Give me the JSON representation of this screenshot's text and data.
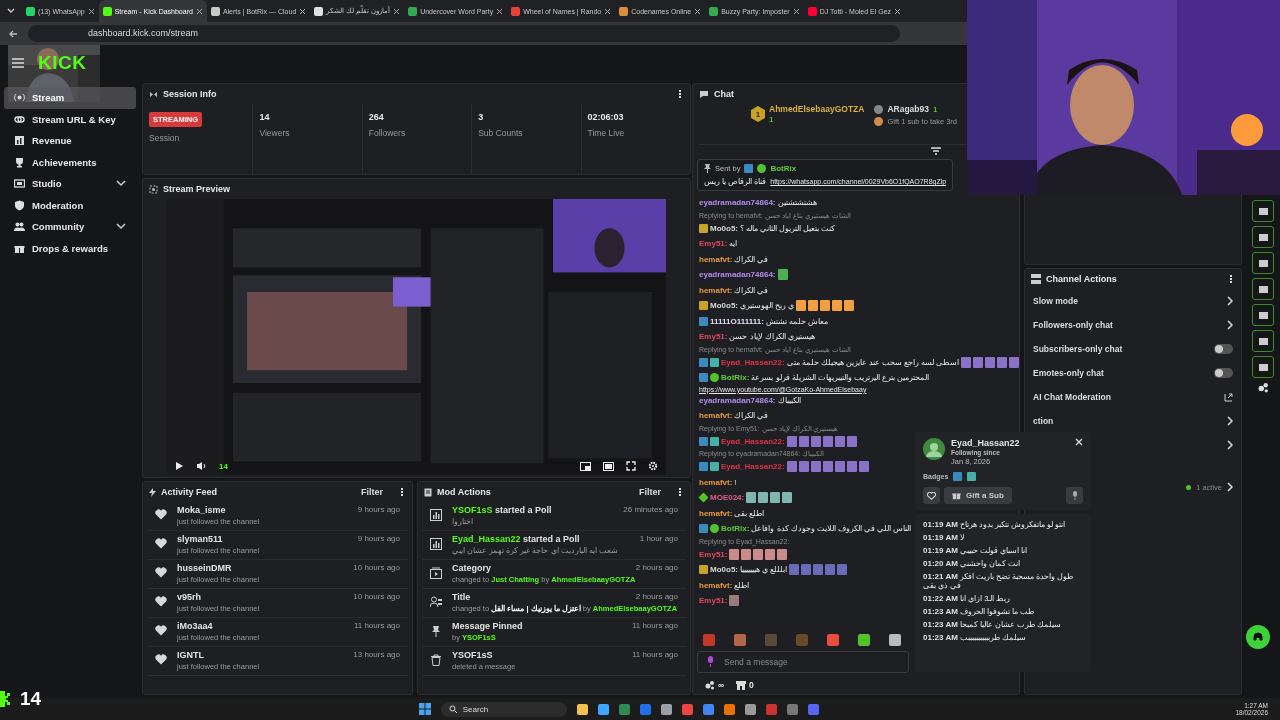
{
  "browser": {
    "tabs": [
      {
        "title": "(13) WhatsApp",
        "selected": false,
        "color": "#25d366"
      },
      {
        "title": "Stream - Kick Dashboard",
        "selected": true,
        "color": "#53fc18"
      },
      {
        "title": "Alerts | BotRix — Cloud",
        "selected": false,
        "color": "#c8c8c8"
      },
      {
        "title": "أمازون تقلّم لك الشكر",
        "selected": false,
        "color": "#e0e0e0"
      },
      {
        "title": "Undercover Word Party",
        "selected": false,
        "color": "#34a853"
      },
      {
        "title": "Wheel of Names | Rando",
        "selected": false,
        "color": "#e94235"
      },
      {
        "title": "Codenames Online",
        "selected": false,
        "color": "#d98c3a"
      },
      {
        "title": "Buzzy Party: Imposter",
        "selected": false,
        "color": "#34a853"
      },
      {
        "title": "DJ Totti - Moled El Gez",
        "selected": false,
        "color": "#ff0033"
      }
    ],
    "address": "dashboard.kick.com/stream"
  },
  "logo": "KICK",
  "sidebar": [
    {
      "label": "Stream",
      "selected": true,
      "has_submenu": false,
      "kind": "stream"
    },
    {
      "label": "Stream URL & Key",
      "selected": false,
      "has_submenu": false,
      "kind": "link"
    },
    {
      "label": "Revenue",
      "selected": false,
      "has_submenu": false,
      "kind": "revenue"
    },
    {
      "label": "Achievements",
      "selected": false,
      "has_submenu": false,
      "kind": "trophy"
    },
    {
      "label": "Studio",
      "selected": false,
      "has_submenu": true,
      "kind": "studio"
    },
    {
      "label": "Moderation",
      "selected": false,
      "has_submenu": false,
      "kind": "shield"
    },
    {
      "label": "Community",
      "selected": false,
      "has_submenu": true,
      "kind": "community"
    },
    {
      "label": "Drops & rewards",
      "selected": false,
      "has_submenu": false,
      "kind": "gift"
    }
  ],
  "session": {
    "title": "Session Info",
    "badge": "STREAMING",
    "stats": [
      {
        "label": "Session"
      },
      {
        "value": "14",
        "label": "Viewers"
      },
      {
        "value": "264",
        "label": "Followers"
      },
      {
        "value": "3",
        "label": "Sub Counts"
      },
      {
        "value": "02:06:03",
        "label": "Time Live"
      }
    ]
  },
  "preview": {
    "title": "Stream Preview",
    "viewers": "14"
  },
  "activity": {
    "title": "Activity Feed",
    "filter": "Filter",
    "items": [
      {
        "name": "Moka_isme",
        "time": "9 hours ago",
        "text": "just followed the channel"
      },
      {
        "name": "slyman511",
        "time": "9 hours ago",
        "text": "just followed the channel"
      },
      {
        "name": "husseinDMR",
        "time": "10 hours ago",
        "text": "just followed the channel"
      },
      {
        "name": "v95rh",
        "time": "10 hours ago",
        "text": "just followed the channel"
      },
      {
        "name": "iMo3aa4",
        "time": "11 hours ago",
        "text": "just followed the channel"
      },
      {
        "name": "IGNTL",
        "time": "13 hours ago",
        "text": "just followed the channel"
      }
    ]
  },
  "mod_actions": {
    "title": "Mod Actions",
    "filter": "Filter",
    "items": [
      {
        "kind": "poll",
        "time": "26 minutes ago",
        "title": [
          {
            "text": "YSOF1sS",
            "kind": "user"
          },
          {
            "text": "started a Poll",
            "kind": "text"
          }
        ],
        "detail": [
          {
            "text": "اختاروا",
            "kind": "text"
          }
        ]
      },
      {
        "kind": "poll",
        "time": "1 hour ago",
        "title": [
          {
            "text": "Eyad_Hassan22",
            "kind": "user"
          },
          {
            "text": "started a Poll",
            "kind": "text"
          }
        ],
        "detail": [
          {
            "text": "شعب ايه اليارديت اي حاجة غير كرة تهمز عشان ايبي",
            "kind": "text"
          }
        ]
      },
      {
        "kind": "category",
        "time": "2 hours ago",
        "title": [
          {
            "text": "Category",
            "kind": "text"
          }
        ],
        "detail": [
          {
            "text": "changed to",
            "kind": "text"
          },
          {
            "text": "Just Chatting",
            "kind": "user"
          },
          {
            "text": "by",
            "kind": "text"
          },
          {
            "text": "AhmedElsebaayGOTZA",
            "kind": "user"
          }
        ]
      },
      {
        "kind": "title",
        "time": "2 hours ago",
        "title": [
          {
            "text": "Title",
            "kind": "text"
          }
        ],
        "detail": [
          {
            "text": "changed to",
            "kind": "text"
          },
          {
            "text": "اعتزل ما يوزنيك | مساء الفل",
            "kind": "quote"
          },
          {
            "text": "by",
            "kind": "text"
          },
          {
            "text": "AhmedElsebaayGOTZA",
            "kind": "user"
          }
        ]
      },
      {
        "kind": "pin",
        "time": "11 hours ago",
        "title": [
          {
            "text": "Message Pinned",
            "kind": "text"
          }
        ],
        "detail": [
          {
            "text": "by",
            "kind": "text"
          },
          {
            "text": "YSOF1sS",
            "kind": "user"
          }
        ]
      },
      {
        "kind": "delete",
        "time": "11 hours ago",
        "title": [
          {
            "text": "YSOF1sS",
            "kind": "text"
          }
        ],
        "detail": [
          {
            "text": "deleted a message",
            "kind": "text"
          }
        ]
      }
    ]
  },
  "chat": {
    "title": "Chat",
    "leaderboard": [
      {
        "rank": "1",
        "name": "AhmedElsebaayGOTZA",
        "count": "1"
      },
      {
        "name": "ARagab93",
        "count": "1"
      }
    ],
    "leaderboard_cta": "Gift 1 sub to take 3rd",
    "pinned": {
      "label": "Sent by",
      "user": "BotRix",
      "text": "قناة الرقاص يا ريس",
      "link": "https://whatsapp.com/channel/0029Vb6O1fQAO7R8gZlp"
    },
    "messages": [
      {
        "user": "eyadramadan74864:",
        "color": "#b58cf0",
        "text": "هشتشتشتين"
      },
      {
        "reply": "Replying to hemafvt: الشات هيستيري بتاع اياد حسن",
        "user": "Mo0o5:",
        "color": "#d8d8d8",
        "badges": [
          {
            "kind": "crown"
          }
        ],
        "text": "كنت بتعيل التريول الثاني ماله ؟"
      },
      {
        "user": "Emy51:",
        "color": "#e0455f",
        "text": "ايه"
      },
      {
        "user": "hemafvt:",
        "color": "#e89a3c",
        "text": "في الكراك"
      },
      {
        "user": "eyadramadan74864:",
        "color": "#b58cf0",
        "emotes": [
          {
            "color": "#4caf50"
          }
        ]
      },
      {
        "user": "hemafvt:",
        "color": "#e89a3c",
        "text": "في الكراك"
      },
      {
        "user": "Mo0o5:",
        "color": "#d8d8d8",
        "badges": [
          {
            "kind": "crown"
          }
        ],
        "text": "ي ربح الهوستيري",
        "emotes": [
          {
            "color": "#f0a040"
          },
          {
            "color": "#f0a040"
          },
          {
            "color": "#f0a040"
          },
          {
            "color": "#f0a040"
          },
          {
            "color": "#f0a040"
          }
        ]
      },
      {
        "user": "11111O111111:",
        "color": "#e4dcf4",
        "badges": [
          {
            "kind": "mod"
          }
        ],
        "text": "معاش حلمه تشتش"
      },
      {
        "user": "Emy51:",
        "color": "#e0455f",
        "text": "هيستيري الكراك لإياد حسن"
      },
      {
        "reply": "Replying to hemafvt: الشات هيستيري بتاع اياد حسن",
        "user": "Eyad_Hassan22:",
        "color": "#e0304a",
        "badges": [
          {
            "kind": "mod"
          },
          {
            "kind": "sub"
          }
        ],
        "text": "اسطى لسه راجع سحب عند عايزين هيجيلك حلمة متى",
        "emotes": [
          {
            "color": "#8a72c8"
          },
          {
            "color": "#8a72c8"
          },
          {
            "color": "#8a72c8"
          },
          {
            "color": "#8a72c8"
          },
          {
            "color": "#8a72c8"
          }
        ]
      },
      {
        "user": "BotRix:",
        "color": "#5cc93a",
        "badges": [
          {
            "kind": "mod"
          },
          {
            "kind": "verified"
          }
        ],
        "text": "المحترمين بترع اليرتريب والتيبريهات الشريلة فرلو بسرعة",
        "link": "https://www.youtube.com/@GotzaKo-AhmedElsebaay"
      },
      {
        "user": "eyadramadan74864:",
        "color": "#b58cf0",
        "text": "الكبيباك"
      },
      {
        "user": "hemafvt:",
        "color": "#e89a3c",
        "text": "في الكراك"
      },
      {
        "reply": "Replying to Emy51: هيستيري الكراك لإياد حسن",
        "user": "Eyad_Hassan22:",
        "color": "#e0304a",
        "badges": [
          {
            "kind": "mod"
          },
          {
            "kind": "sub"
          }
        ],
        "emotes": [
          {
            "color": "#8a72c8"
          },
          {
            "color": "#8a72c8"
          },
          {
            "color": "#8a72c8"
          },
          {
            "color": "#8a72c8"
          },
          {
            "color": "#8a72c8"
          },
          {
            "color": "#8a72c8"
          }
        ]
      },
      {
        "reply": "Replying to eyadramadan74864: الكبيباك",
        "user": "Eyad_Hassan22:",
        "color": "#e0304a",
        "badges": [
          {
            "kind": "mod"
          },
          {
            "kind": "sub"
          }
        ],
        "emotes": [
          {
            "color": "#8a72c8"
          },
          {
            "color": "#8a72c8"
          },
          {
            "color": "#8a72c8"
          },
          {
            "color": "#8a72c8"
          },
          {
            "color": "#8a72c8"
          },
          {
            "color": "#8a72c8"
          },
          {
            "color": "#8a72c8"
          }
        ]
      },
      {
        "user": "hemafvt:",
        "color": "#e89a3c",
        "text": "!"
      },
      {
        "user": "MOE024:",
        "color": "#e05a8c",
        "badges": [
          {
            "kind": "diamond"
          }
        ],
        "emotes": [
          {
            "color": "#7fb7b0"
          },
          {
            "color": "#7fb7b0"
          },
          {
            "color": "#7fb7b0"
          },
          {
            "color": "#7fb7b0"
          }
        ]
      },
      {
        "user": "hemafvt:",
        "color": "#e89a3c",
        "text": "اطلع بقى"
      },
      {
        "user": "BotRix:",
        "color": "#5cc93a",
        "badges": [
          {
            "kind": "mod"
          },
          {
            "kind": "verified"
          }
        ],
        "text": "الناس اللي في الكروف اللايت وجودك كدة وافاعل"
      },
      {
        "reply": "Replying to Eyad_Hassan22:",
        "user": "Emy51:",
        "color": "#e0455f",
        "emotes": [
          {
            "color": "#c98a8a"
          },
          {
            "color": "#c98a8a"
          },
          {
            "color": "#c98a8a"
          },
          {
            "color": "#c98a8a"
          },
          {
            "color": "#c98a8a"
          }
        ]
      },
      {
        "user": "Mo0o5:",
        "color": "#d8d8d8",
        "badges": [
          {
            "kind": "crown"
          }
        ],
        "text": "ابلللع ي هيييييييا",
        "emotes": [
          {
            "color": "#6a6ab8"
          },
          {
            "color": "#6a6ab8"
          },
          {
            "color": "#6a6ab8"
          },
          {
            "color": "#6a6ab8"
          },
          {
            "color": "#6a6ab8"
          }
        ]
      },
      {
        "user": "hemafvt:",
        "color": "#e89a3c",
        "text": "اطلع"
      },
      {
        "user": "Emy51:",
        "color": "#e0455f",
        "emotes": [
          {
            "color": "#9a7a7a"
          }
        ]
      }
    ],
    "emote_bar": [
      {
        "color": "#c0392b"
      },
      {
        "color": "#b5654a"
      },
      {
        "color": "#5a4a3a"
      },
      {
        "color": "#6b4a2a"
      },
      {
        "color": "#e74c3c"
      },
      {
        "color": "#53c22b"
      },
      {
        "color": "#bbbbbb"
      }
    ],
    "input": {
      "placeholder": "Send a message"
    },
    "footer": [
      {
        "kind": "points",
        "value": "∞"
      },
      {
        "kind": "store",
        "value": "0"
      }
    ]
  },
  "user_card": {
    "name": "Eyad_Hassan22",
    "following_label": "Following since",
    "following_date": "Jan 8, 2026",
    "badges_label": "Badges",
    "badges": [
      {
        "kind": "mod"
      },
      {
        "kind": "sub"
      }
    ],
    "gift": "Gift a Sub",
    "history": [
      {
        "time": "01:19 AM",
        "text": "انتو لو ماتفكروش تتكبر بدود هرتاح"
      },
      {
        "time": "01:19 AM",
        "text": "لا"
      },
      {
        "time": "01:19 AM",
        "text": "انا اسباي قولت حبيبي"
      },
      {
        "time": "01:20 AM",
        "text": "انت كمان واحشني"
      },
      {
        "time": "01:21 AM",
        "text": "طول واحدة مسحبة تضح باريت افكر في ذي بقى"
      },
      {
        "time": "01:22 AM",
        "text": "ربط الـ3 ازاي انا"
      },
      {
        "time": "01:23 AM",
        "text": "طب ما تشوفوا الحروف"
      },
      {
        "time": "01:23 AM",
        "text": "سيلمك طرب عشان عالبا كمبحا"
      },
      {
        "time": "01:23 AM",
        "text": "سيلمك طربببببببببببب"
      }
    ]
  },
  "channel_actions": {
    "title": "Channel Actions",
    "rows": [
      {
        "kind": "arrow",
        "label": "Slow mode"
      },
      {
        "kind": "arrow",
        "label": "Followers-only chat"
      },
      {
        "kind": "toggle",
        "label": "Subscribers-only chat",
        "on": false
      },
      {
        "kind": "toggle",
        "label": "Emotes-only chat",
        "on": false
      },
      {
        "kind": "external",
        "label": "AI Chat Moderation"
      },
      {
        "kind": "arrow",
        "label": "ction"
      },
      {
        "kind": "arrow"
      },
      {
        "kind": "status",
        "status": "1 active"
      }
    ]
  },
  "overlay": {
    "viewers": "14"
  },
  "taskbar": {
    "search": "Search",
    "time": "1:27 AM",
    "date": "18/02/2026"
  }
}
